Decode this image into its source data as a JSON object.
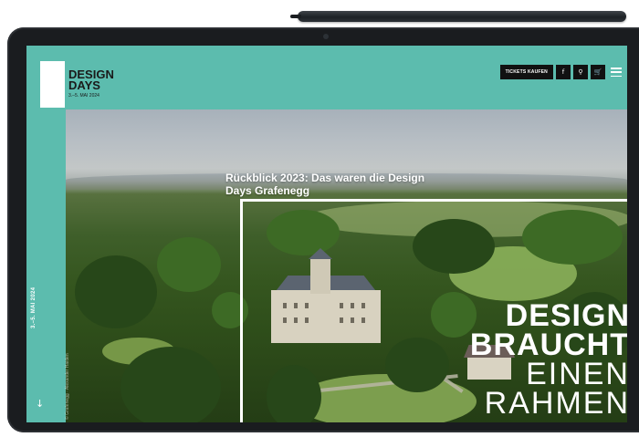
{
  "header": {
    "logo_line1": "DESIGN",
    "logo_line2": "DAYS",
    "logo_date": "3.–5. MAI 2024",
    "tickets_label": "TICKETS KAUFEN",
    "icons": [
      "facebook-icon",
      "search-icon",
      "cart-icon",
      "menu-icon"
    ],
    "facebook_glyph": "f",
    "search_glyph": "⚲",
    "cart_glyph": "🛒"
  },
  "sidebar": {
    "date": "3.–5. MAI 2024",
    "arrow": "↓"
  },
  "hero": {
    "headline_line1": "Rückblick 2023: Das waren die Design",
    "headline_line2": "Days Grafenegg",
    "copyright": "© Grafenegg · Alexander Haiden",
    "big_line1": "DESIGN",
    "big_line2": "BRAUCHT",
    "big_line3": "EINEN",
    "big_line4": "RAHMEN"
  },
  "colors": {
    "brand": "#5cbcae",
    "dark": "#111111",
    "white": "#ffffff"
  }
}
